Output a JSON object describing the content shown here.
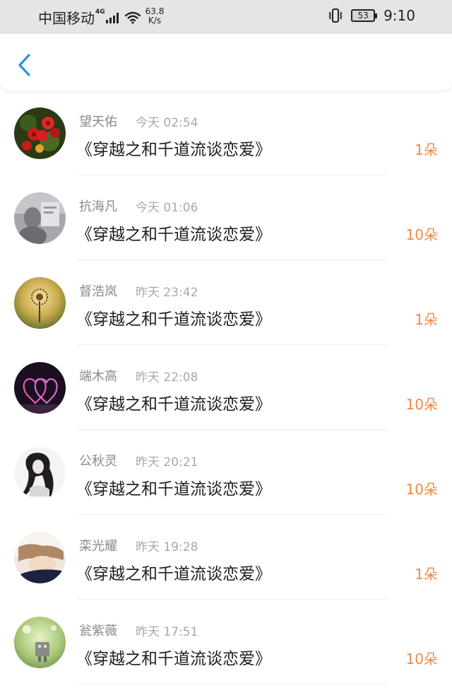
{
  "status_bar": {
    "carrier": "中国移动",
    "network_type": "4G",
    "net_speed_value": "63.8",
    "net_speed_unit": "K/s",
    "battery": "53",
    "time": "9:10"
  },
  "header": {
    "back_icon": "chevron-left-icon",
    "accent": "#2196f3"
  },
  "colors": {
    "name": "#8a8a8a",
    "time": "#a9a9a9",
    "title": "#1f1f1f",
    "flowers": "#f0884a"
  },
  "records": [
    {
      "name": "望天佑",
      "time": "今天 02:54",
      "title": "《穿越之和千道流谈恋爱》",
      "flowers": "1朵"
    },
    {
      "name": "抗海凡",
      "time": "今天 01:06",
      "title": "《穿越之和千道流谈恋爱》",
      "flowers": "10朵"
    },
    {
      "name": "督浩岚",
      "time": "昨天 23:42",
      "title": "《穿越之和千道流谈恋爱》",
      "flowers": "1朵"
    },
    {
      "name": "端木高",
      "time": "昨天 22:08",
      "title": "《穿越之和千道流谈恋爱》",
      "flowers": "10朵"
    },
    {
      "name": "公秋灵",
      "time": "昨天 20:21",
      "title": "《穿越之和千道流谈恋爱》",
      "flowers": "10朵"
    },
    {
      "name": "栾光耀",
      "time": "昨天 19:28",
      "title": "《穿越之和千道流谈恋爱》",
      "flowers": "1朵"
    },
    {
      "name": "瓮紫薇",
      "time": "昨天 17:51",
      "title": "《穿越之和千道流谈恋爱》",
      "flowers": "10朵"
    }
  ]
}
